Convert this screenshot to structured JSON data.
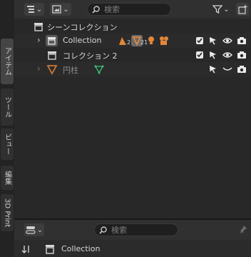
{
  "side_tabs": [
    "アイテム",
    "ツール",
    "ビュー",
    "編集",
    "3D Print"
  ],
  "header": {
    "search_placeholder": "検索"
  },
  "tree": {
    "scene_collection": "シーンコレクション",
    "collection_1": {
      "label": "Collection",
      "badge_mesh": "2",
      "badge_active": "21"
    },
    "collection_2": {
      "label": "コレクション 2"
    },
    "object_1": {
      "label": "円柱"
    }
  },
  "bottom": {
    "search_placeholder": "検索",
    "collection_label": "Collection"
  },
  "colors": {
    "accent_orange": "#e3873a",
    "mesh_green": "#3fbf77",
    "panel_bg": "#282828"
  }
}
